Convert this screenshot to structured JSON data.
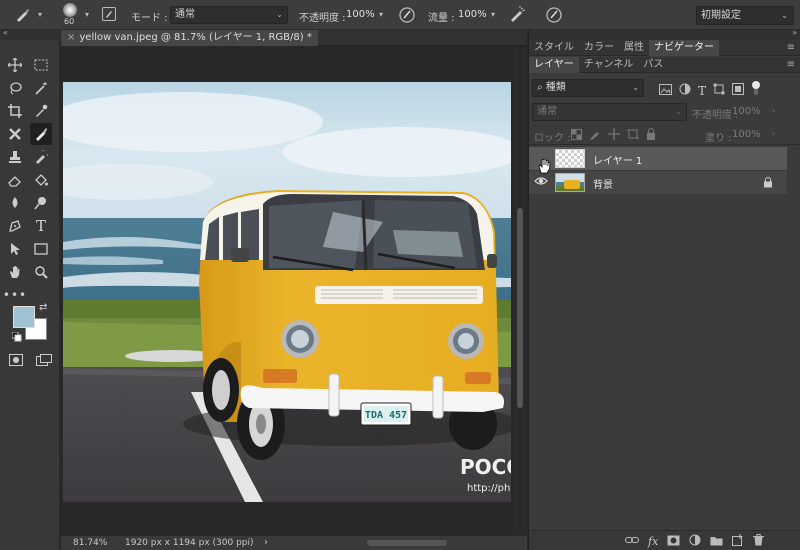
{
  "options_bar": {
    "brush_size": "60",
    "mode_label": "モード :",
    "mode_value": "通常",
    "opacity_label": "不透明度 :",
    "opacity_value": "100%",
    "flow_label": "流量 :",
    "flow_value": "100%",
    "workspace": "初期設定"
  },
  "document": {
    "tab_title": "yellow van.jpeg @ 81.7% (レイヤー 1, RGB/8) *",
    "zoom": "81.74%",
    "info": "1920 px x 1194 px (300 ppi)",
    "plate_text": "TDA 457",
    "watermark_brand": "POCO 摄影专题",
    "watermark_url": "http://photo.poco.cn/"
  },
  "panel": {
    "top_tabs": [
      "スタイル",
      "カラー",
      "属性",
      "ナビゲーター"
    ],
    "tabs": [
      "レイヤー",
      "チャンネル",
      "パス"
    ],
    "filter_value": "種類",
    "blend_mode": "通常",
    "opacity_label": "不透明度 :",
    "opacity_value": "100%",
    "lock_label": "ロック :",
    "fill_label": "塗り :",
    "fill_value": "100%",
    "layers": [
      {
        "name": "レイヤー 1",
        "visible": false,
        "selected": true,
        "locked": false
      },
      {
        "name": "背景",
        "visible": true,
        "selected": false,
        "locked": true
      }
    ]
  },
  "colors": {
    "foreground": "#9fc3d2",
    "background": "#ffffff",
    "van_yellow": "#e8b122"
  }
}
